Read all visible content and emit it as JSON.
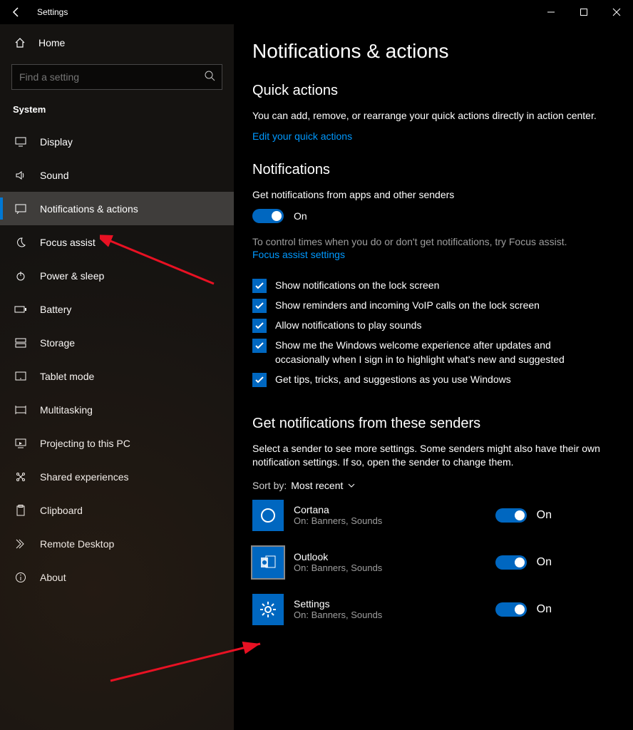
{
  "titlebar": {
    "title": "Settings"
  },
  "sidebar": {
    "home": "Home",
    "search_placeholder": "Find a setting",
    "group": "System",
    "items": [
      {
        "label": "Display"
      },
      {
        "label": "Sound"
      },
      {
        "label": "Notifications & actions"
      },
      {
        "label": "Focus assist"
      },
      {
        "label": "Power & sleep"
      },
      {
        "label": "Battery"
      },
      {
        "label": "Storage"
      },
      {
        "label": "Tablet mode"
      },
      {
        "label": "Multitasking"
      },
      {
        "label": "Projecting to this PC"
      },
      {
        "label": "Shared experiences"
      },
      {
        "label": "Clipboard"
      },
      {
        "label": "Remote Desktop"
      },
      {
        "label": "About"
      }
    ]
  },
  "main": {
    "title": "Notifications & actions",
    "quick_actions": {
      "heading": "Quick actions",
      "desc": "You can add, remove, or rearrange your quick actions directly in action center.",
      "link": "Edit your quick actions"
    },
    "notifications": {
      "heading": "Notifications",
      "toggle_label": "Get notifications from apps and other senders",
      "on": "On",
      "focus_hint": "To control times when you do or don't get notifications, try Focus assist.",
      "focus_link": "Focus assist settings",
      "checks": [
        "Show notifications on the lock screen",
        "Show reminders and incoming VoIP calls on the lock screen",
        "Allow notifications to play sounds",
        "Show me the Windows welcome experience after updates and occasionally when I sign in to highlight what's new and suggested",
        "Get tips, tricks, and suggestions as you use Windows"
      ]
    },
    "senders": {
      "heading": "Get notifications from these senders",
      "desc": "Select a sender to see more settings. Some senders might also have their own notification settings. If so, open the sender to change them.",
      "sort_label": "Sort by:",
      "sort_value": "Most recent",
      "on": "On",
      "items": [
        {
          "name": "Cortana",
          "sub": "On: Banners, Sounds"
        },
        {
          "name": "Outlook",
          "sub": "On: Banners, Sounds"
        },
        {
          "name": "Settings",
          "sub": "On: Banners, Sounds"
        }
      ]
    }
  }
}
